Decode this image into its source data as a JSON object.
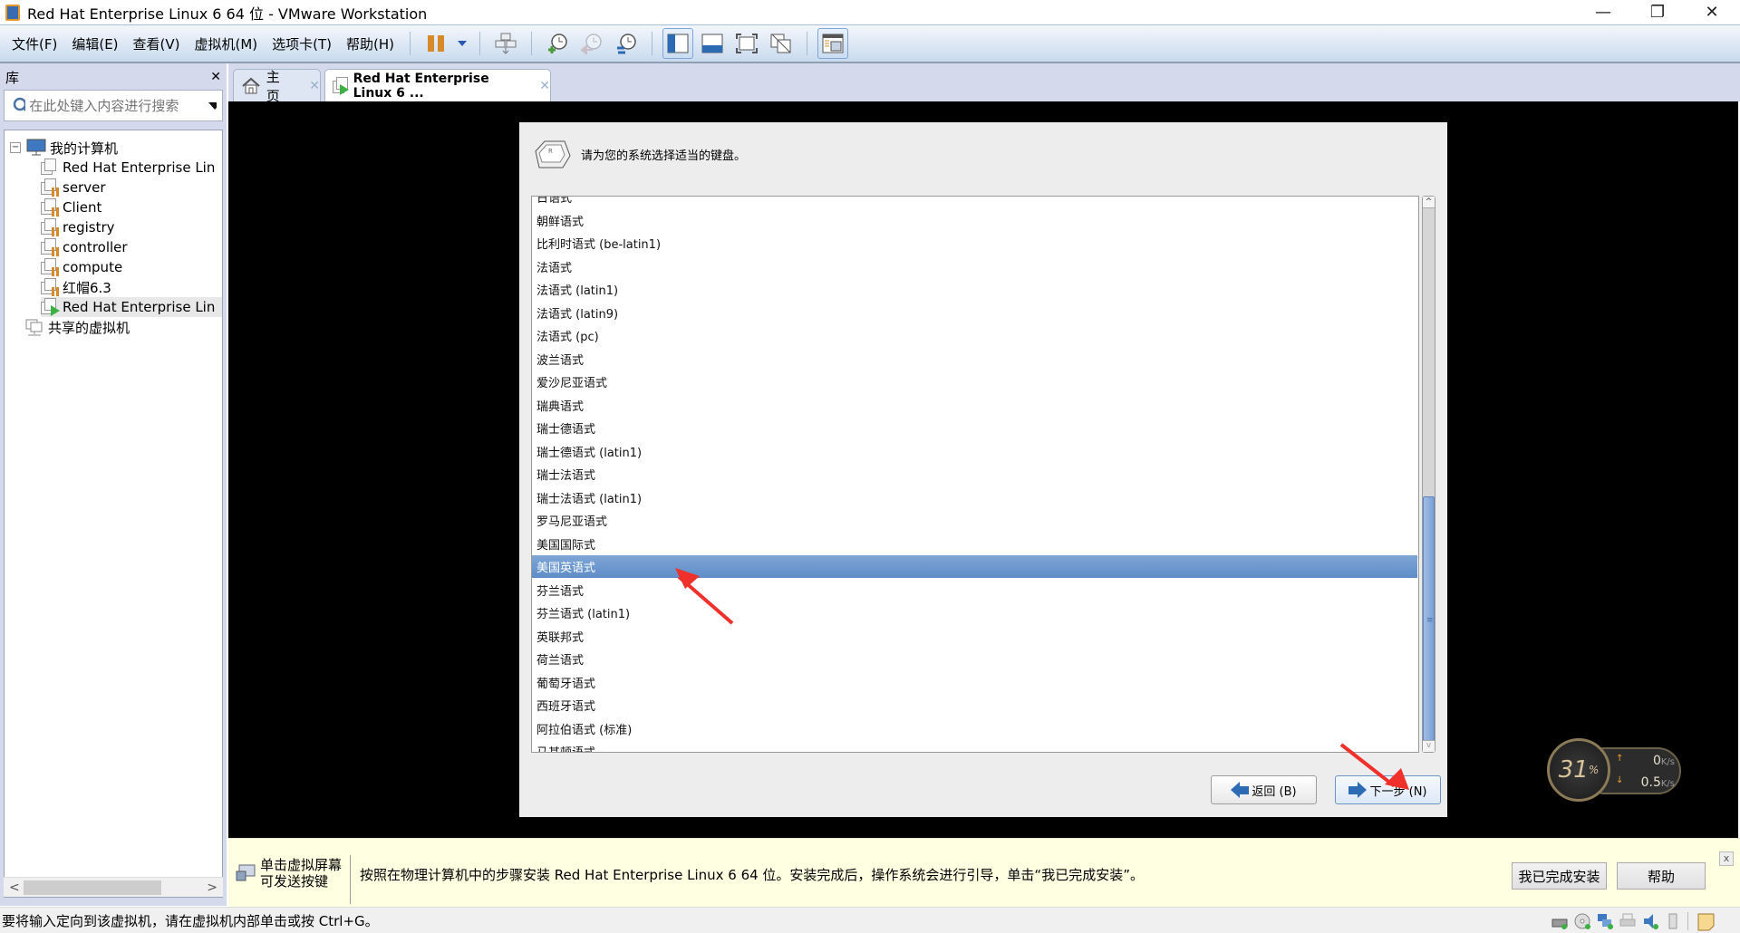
{
  "window": {
    "title": "Red Hat Enterprise Linux 6 64 位 - VMware Workstation",
    "controls": {
      "minimize": "—",
      "restore": "❐",
      "close": "✕"
    }
  },
  "menu": [
    "文件(F)",
    "编辑(E)",
    "查看(V)",
    "虚拟机(M)",
    "选项卡(T)",
    "帮助(H)"
  ],
  "toolbar": {
    "buttons": [
      "pause-icon",
      "dropdown-icon",
      "send-ctrl-alt-del-icon",
      "take-snapshot-icon",
      "revert-snapshot-icon",
      "snapshot-manager-icon",
      "show-library-icon",
      "thumbnail-bar-icon",
      "full-screen-icon",
      "unity-icon",
      "console-view-icon"
    ]
  },
  "library": {
    "title": "库",
    "close": "✕",
    "search_placeholder": "在此处键入内容进行搜索",
    "tree": {
      "root": "我的计算机",
      "vms": [
        {
          "name": "Red Hat Enterprise Lin",
          "state": "off"
        },
        {
          "name": "server",
          "state": "suspended"
        },
        {
          "name": "Client",
          "state": "suspended"
        },
        {
          "name": "registry",
          "state": "suspended"
        },
        {
          "name": "controller",
          "state": "suspended"
        },
        {
          "name": "compute",
          "state": "suspended"
        },
        {
          "name": "红帽6.3",
          "state": "suspended"
        },
        {
          "name": "Red Hat Enterprise Lin",
          "state": "running",
          "selected": true
        }
      ],
      "shared": "共享的虚拟机"
    }
  },
  "tabs": [
    {
      "label": "主页",
      "icon": "home-icon",
      "active": false
    },
    {
      "label": "Red Hat Enterprise Linux 6 ...",
      "icon": "vm-running-icon",
      "active": true
    }
  ],
  "dialog": {
    "prompt": "请为您的系统选择适当的键盘。",
    "keyboards": [
      "日语式",
      "朝鲜语式",
      "比利时语式 (be-latin1)",
      "法语式",
      "法语式 (latin1)",
      "法语式 (latin9)",
      "法语式 (pc)",
      "波兰语式",
      "爱沙尼亚语式",
      "瑞典语式",
      "瑞士德语式",
      "瑞士德语式 (latin1)",
      "瑞士法语式",
      "瑞士法语式 (latin1)",
      "罗马尼亚语式",
      "美国国际式",
      "美国英语式",
      "芬兰语式",
      "芬兰语式 (latin1)",
      "英联邦式",
      "荷兰语式",
      "葡萄牙语式",
      "西班牙语式",
      "阿拉伯语式 (标准)",
      "马其顿语式"
    ],
    "selected": "美国英语式",
    "scroll_position": 0.54,
    "back_label": "返回 (B)",
    "next_label": "下一步 (N)"
  },
  "net_monitor": {
    "cpu_percent": "31",
    "percent_sign": "%",
    "up": "0",
    "down": "0.5",
    "unit": "K/s"
  },
  "notification": {
    "hint_line1": "单击虚拟屏幕",
    "hint_line2": "可发送按键",
    "message": "按照在物理计算机中的步骤安装 Red Hat Enterprise Linux 6 64 位。安装完成后，操作系统会进行引导，单击“我已完成安装”。",
    "done_button": "我已完成安装",
    "help_button": "帮助",
    "close": "x"
  },
  "status": {
    "text": "要将输入定向到该虚拟机，请在虚拟机内部单击或按 Ctrl+G。",
    "devices": [
      "hard-disk-icon",
      "cd-dvd-icon",
      "network-adapter-icon",
      "printer-icon",
      "sound-card-icon",
      "usb-icon",
      "message-log-icon"
    ]
  },
  "colors": {
    "selection": "#6b96cd",
    "accent_red": "#f0302a",
    "notify_bg": "#ffffe1",
    "panel_bg": "#d4daec"
  }
}
